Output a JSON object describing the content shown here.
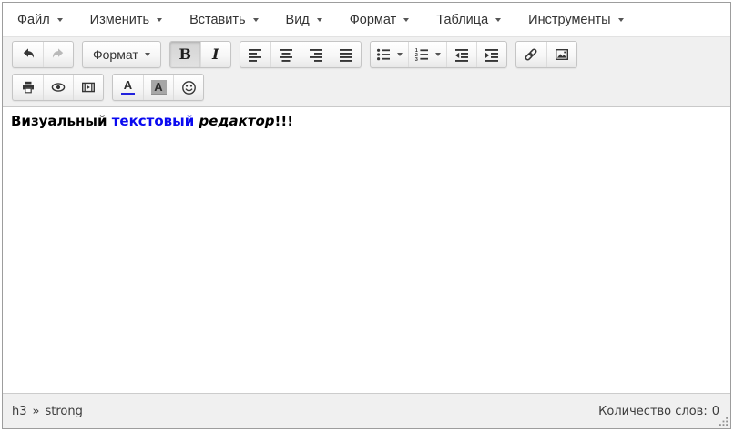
{
  "menubar": {
    "items": [
      {
        "label": "Файл"
      },
      {
        "label": "Изменить"
      },
      {
        "label": "Вставить"
      },
      {
        "label": "Вид"
      },
      {
        "label": "Формат"
      },
      {
        "label": "Таблица"
      },
      {
        "label": "Инструменты"
      }
    ]
  },
  "toolbar": {
    "format_dropdown_label": "Формат",
    "bold_glyph": "B",
    "italic_glyph": "I",
    "forecolor_glyph": "A",
    "backcolor_glyph": "A",
    "row1_icons": [
      "undo-icon",
      "redo-icon",
      "format-dropdown",
      "bold-button",
      "italic-button",
      "align-left-icon",
      "align-center-icon",
      "align-right-icon",
      "align-justify-icon",
      "bullet-list-icon",
      "numbered-list-icon",
      "outdent-icon",
      "indent-icon",
      "link-icon",
      "image-icon"
    ],
    "row2_icons": [
      "print-icon",
      "preview-icon",
      "media-icon",
      "forecolor-icon",
      "backcolor-icon",
      "emoticons-icon"
    ],
    "bold_active": true,
    "redo_disabled": true
  },
  "content": {
    "segments": [
      {
        "text": "Визуальный ",
        "style": "bold"
      },
      {
        "text": "текстовый",
        "style": "bold-blue"
      },
      {
        "text": " ",
        "style": "bold"
      },
      {
        "text": "редактор",
        "style": "bold-italic"
      },
      {
        "text": "!!!",
        "style": "bold"
      }
    ]
  },
  "statusbar": {
    "path": [
      {
        "label": "h3"
      },
      {
        "label": "strong"
      }
    ],
    "path_separator": "»",
    "wordcount_label": "Количество слов:",
    "wordcount_value": "0"
  },
  "colors": {
    "content_blue": "#0a0af0",
    "forecolor_indicator": "#2222dd",
    "backcolor_swatch": "#a7a7a7",
    "toolbar_bg": "#f0f0f0",
    "border": "#9d9d9d",
    "icon": "#363636",
    "icon_disabled": "#b9b9b9"
  }
}
